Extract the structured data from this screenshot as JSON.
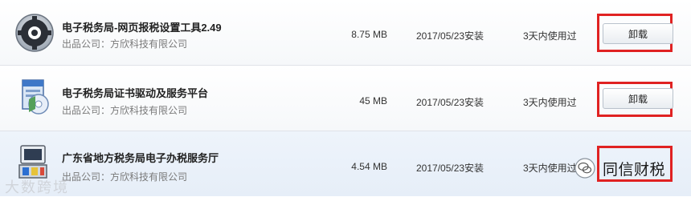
{
  "programs": [
    {
      "name": "电子税务局-网页报税设置工具2.49",
      "publisher": "出品公司：方欣科技有限公司",
      "size": "8.75 MB",
      "install_date": "2017/05/23安装",
      "usage": "3天内使用过",
      "action_label": "卸载",
      "icon": "gear-icon"
    },
    {
      "name": "电子税务局证书驱动及服务平台",
      "publisher": "出品公司：方欣科技有限公司",
      "size": "45 MB",
      "install_date": "2017/05/23安装",
      "usage": "3天内使用过",
      "action_label": "卸载",
      "icon": "installer-box-icon"
    },
    {
      "name": "广东省地方税务局电子办税服务厅",
      "publisher": "出品公司：方欣科技有限公司",
      "size": "4.54 MB",
      "install_date": "2017/05/23安装",
      "usage": "3天内使用过",
      "icon": "installer-computer-icon"
    }
  ],
  "watermark": {
    "brand_text": "同信财税",
    "corner_text": "大数跨境"
  },
  "colors": {
    "highlight": "#e02222",
    "row_selected": "#eef4fb"
  }
}
